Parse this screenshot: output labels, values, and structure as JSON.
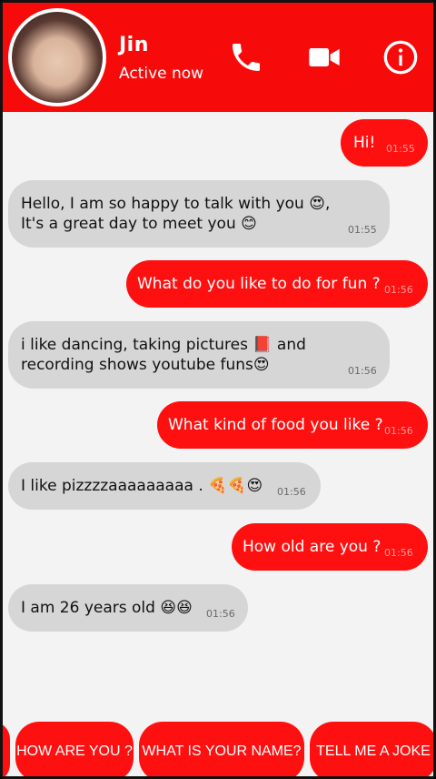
{
  "header": {
    "name": "Jin",
    "status": "Active now"
  },
  "messages": [
    {
      "from": "me",
      "text": "Hi!",
      "time": "01:55"
    },
    {
      "from": "them",
      "text": "Hello, I am so happy to talk with you 😍,\nIt's a great day to meet you 😊",
      "time": "01:55"
    },
    {
      "from": "me",
      "text": "What do you like to do for fun ?",
      "time": "01:56"
    },
    {
      "from": "them",
      "text": "i like dancing, taking pictures 📕 and\nrecording shows youtube funs😍",
      "time": "01:56"
    },
    {
      "from": "me",
      "text": "What kind of food you like ?",
      "time": "01:56"
    },
    {
      "from": "them",
      "text": "I like pizzzzaaaaaaaaa . 🍕🍕😍",
      "time": "01:56"
    },
    {
      "from": "me",
      "text": "How old are you ?",
      "time": "01:56"
    },
    {
      "from": "them",
      "text": "I am 26 years old 😆😆",
      "time": "01:56"
    }
  ],
  "quick_replies": [
    "HOW ARE YOU ?",
    "WHAT IS YOUR NAME?",
    "TELL ME A JOKE"
  ],
  "colors": {
    "accent": "#f70a0a",
    "incoming": "#d6d6d6",
    "background": "#f3f3f3"
  },
  "icons": [
    "phone-icon",
    "video-camera-icon",
    "info-icon"
  ]
}
